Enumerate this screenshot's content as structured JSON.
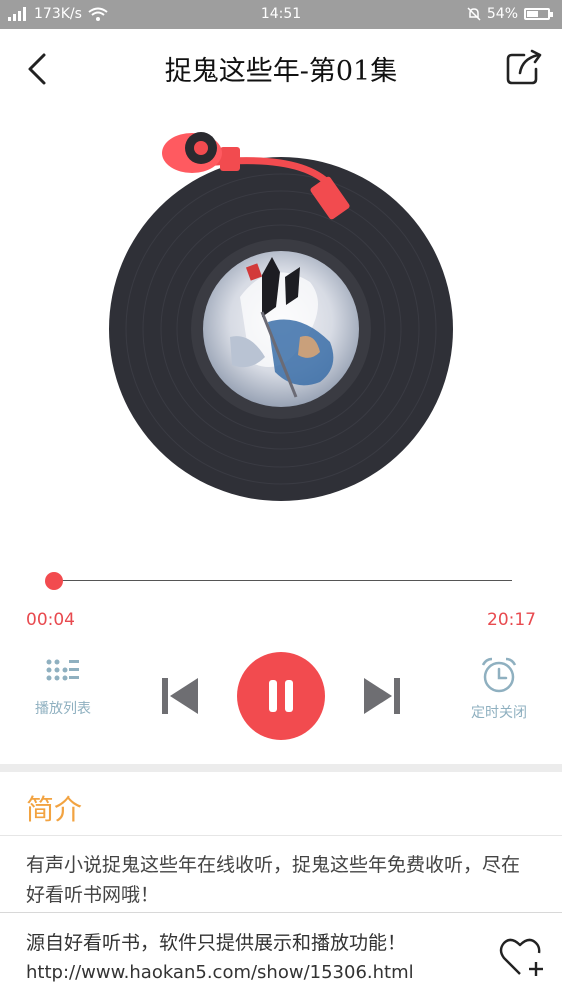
{
  "status_bar": {
    "network": "173K/s",
    "time": "14:51",
    "battery": "54%",
    "battery_level": 0.54
  },
  "header": {
    "title": "捉鬼这些年-第01集"
  },
  "player": {
    "progress": 0.0033,
    "current_time": "00:04",
    "total_time": "20:17",
    "playlist_label": "播放列表",
    "timer_label": "定时关闭"
  },
  "intro": {
    "title": "简介",
    "text": "有声小说捉鬼这些年在线收听，捉鬼这些年免费收听，尽在好看听书网哦！"
  },
  "footer": {
    "source": "源自好看听书，软件只提供展示和播放功能！",
    "url": "http://www.haokan5.com/show/15306.html"
  },
  "colors": {
    "accent": "#f24b4f",
    "intro_title": "#f2a341",
    "side_button": "#8fb0c0",
    "disc": "#2f3037"
  },
  "icons": [
    "back-arrow-icon",
    "share-icon",
    "playlist-icon",
    "previous-icon",
    "pause-icon",
    "next-icon",
    "alarm-clock-icon",
    "heart-plus-icon"
  ]
}
